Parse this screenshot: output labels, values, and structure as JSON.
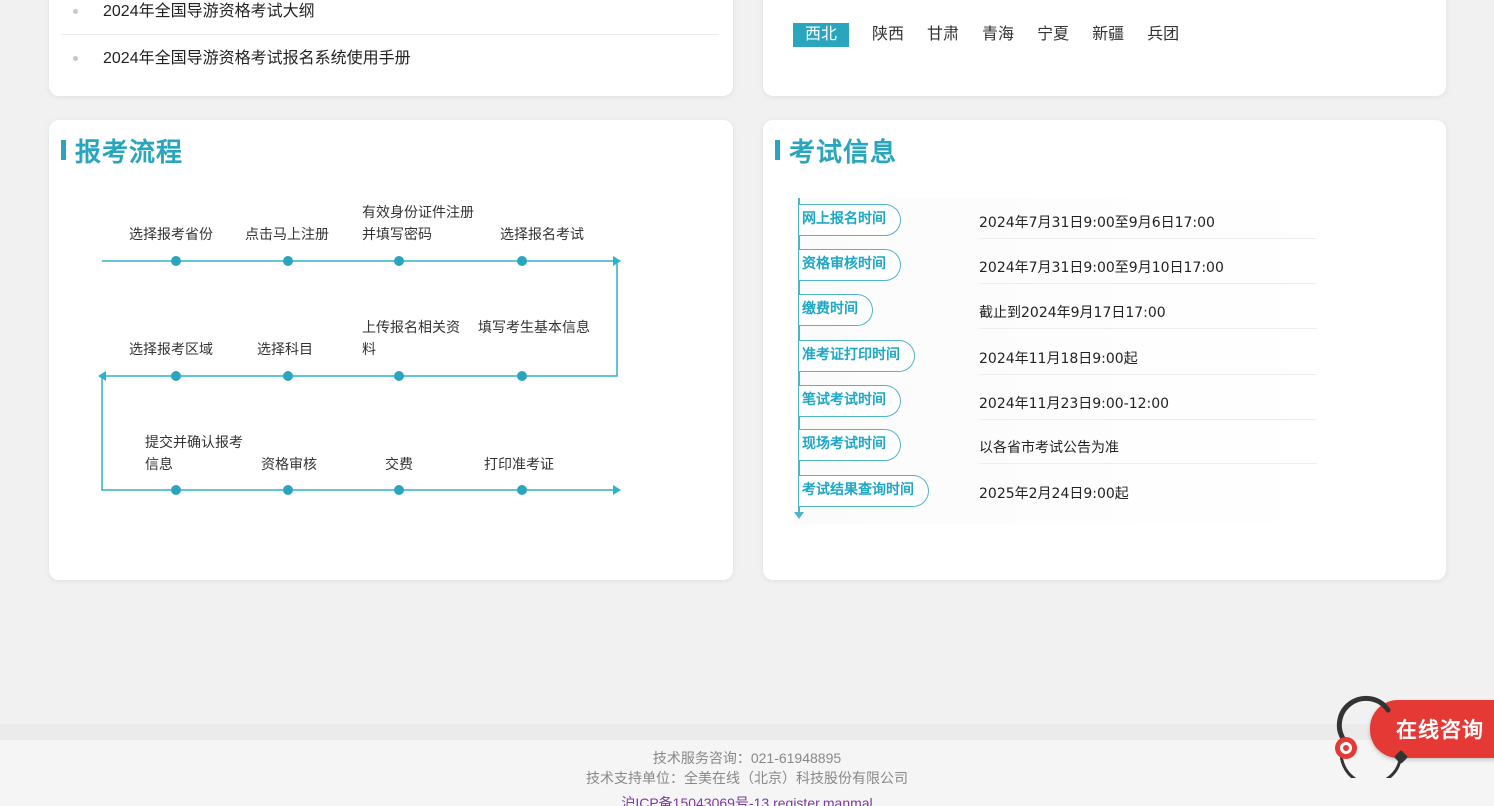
{
  "news": {
    "items": [
      "2024年全国导游资格考试大纲",
      "2024年全国导游资格考试报名系统使用手册"
    ]
  },
  "regions": {
    "active": "西北",
    "tabs": [
      "陕西",
      "甘肃",
      "青海",
      "宁夏",
      "新疆",
      "兵团"
    ]
  },
  "flow": {
    "title": "报考流程",
    "row1": [
      "选择报考省份",
      "点击马上注册",
      "有效身份证件注册并填写密码",
      "选择报名考试"
    ],
    "row2": [
      "选择报考区域",
      "选择科目",
      "上传报名相关资料",
      "填写考生基本信息"
    ],
    "row3": [
      "提交并确认报考信息",
      "资格审核",
      "交费",
      "打印准考证"
    ]
  },
  "exam": {
    "title": "考试信息",
    "rows": [
      {
        "label": "网上报名时间",
        "value": "2024年7月31日9:00至9月6日17:00"
      },
      {
        "label": "资格审核时间",
        "value": "2024年7月31日9:00至9月10日17:00"
      },
      {
        "label": "缴费时间",
        "value": "截止到2024年9月17日17:00"
      },
      {
        "label": "准考证打印时间",
        "value": "2024年11月18日9:00起"
      },
      {
        "label": "笔试考试时间",
        "value": "2024年11月23日9:00-12:00"
      },
      {
        "label": "现场考试时间",
        "value": "以各省市考试公告为准"
      },
      {
        "label": "考试结果查询时间",
        "value": "2025年2月24日9:00起"
      }
    ]
  },
  "footer": {
    "service": "技术服务咨询：021-61948895",
    "support": "技术支持单位：全美在线（北京）科技股份有限公司",
    "icp": "沪ICP备15043069号-13    register.manmal"
  },
  "consult": {
    "label": "在线咨询",
    "accent": "#e53935"
  },
  "colors": {
    "accent": "#2aa5be"
  }
}
